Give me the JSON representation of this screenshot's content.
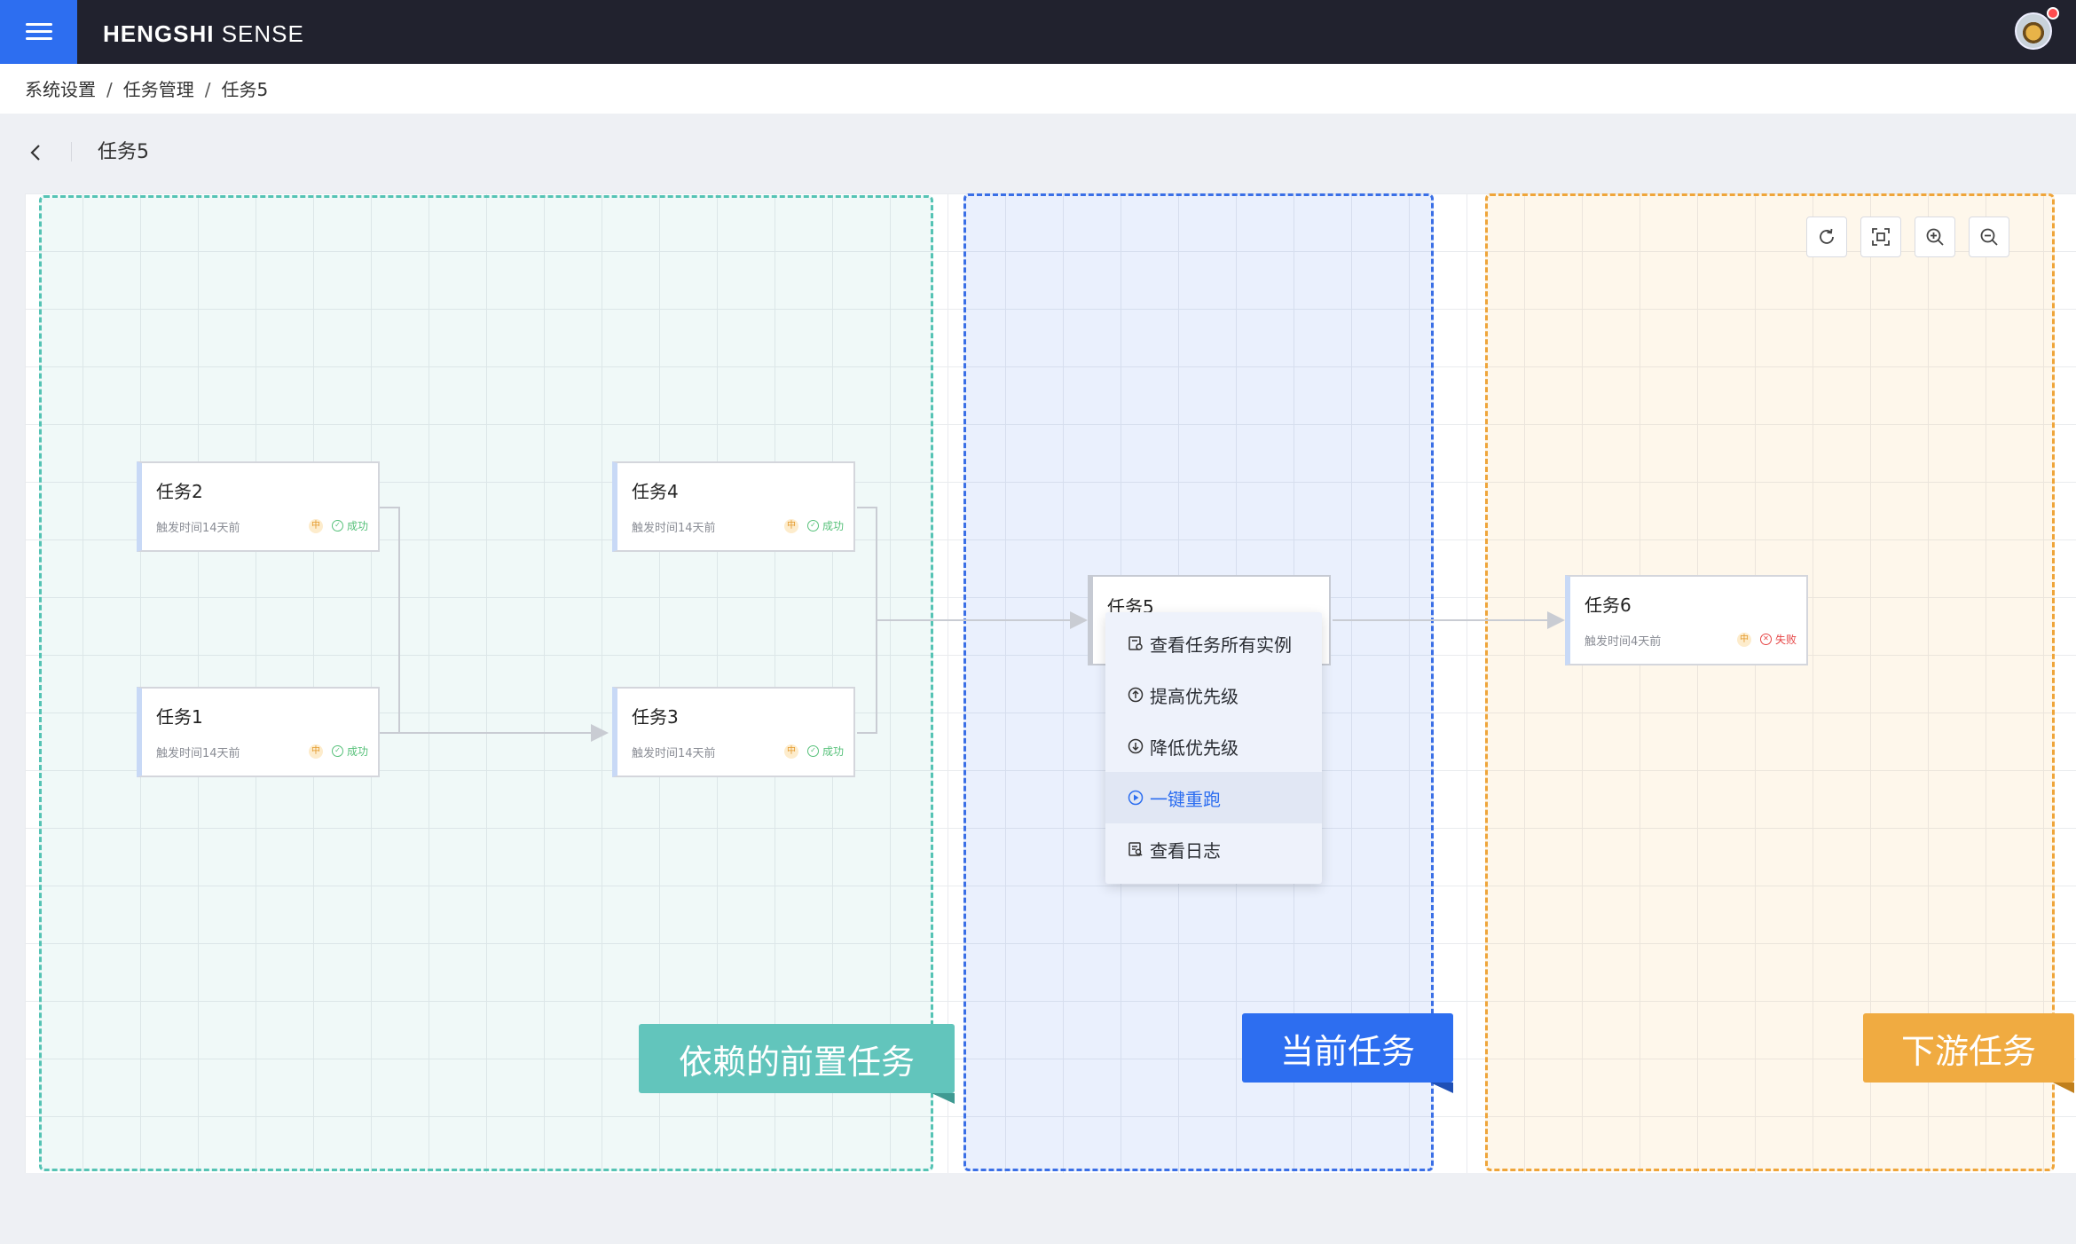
{
  "app": {
    "brand_bold": "HENGSHI",
    "brand_light": " SENSE"
  },
  "breadcrumb": {
    "items": [
      "系统设置",
      "任务管理",
      "任务5"
    ],
    "separator": "/"
  },
  "page": {
    "title": "任务5"
  },
  "toolbar": {
    "icons": [
      "refresh-icon",
      "fit-view-icon",
      "zoom-in-icon",
      "zoom-out-icon"
    ]
  },
  "nodes": [
    {
      "id": "task2",
      "title": "任务2",
      "time": "触发时间14天前",
      "priority": "中",
      "status": "成功"
    },
    {
      "id": "task4",
      "title": "任务4",
      "time": "触发时间14天前",
      "priority": "中",
      "status": "成功"
    },
    {
      "id": "task1",
      "title": "任务1",
      "time": "触发时间14天前",
      "priority": "中",
      "status": "成功"
    },
    {
      "id": "task3",
      "title": "任务3",
      "time": "触发时间14天前",
      "priority": "中",
      "status": "成功"
    },
    {
      "id": "task5",
      "title": "任务5"
    },
    {
      "id": "task6",
      "title": "任务6",
      "time": "触发时间4天前",
      "priority": "中",
      "status": "失败"
    }
  ],
  "context_menu": {
    "items": [
      "查看任务所有实例",
      "提高优先级",
      "降低优先级",
      "一键重跑",
      "查看日志"
    ],
    "active_index": 3
  },
  "zones": {
    "upstream_label": "依赖的前置任务",
    "current_label": "当前任务",
    "downstream_label": "下游任务"
  },
  "colors": {
    "accent": "#2d6ef0",
    "upstream": "#55c3b4",
    "current": "#3a6fe6",
    "downstream": "#efa53a",
    "success": "#57c17a",
    "fail": "#e64545"
  }
}
